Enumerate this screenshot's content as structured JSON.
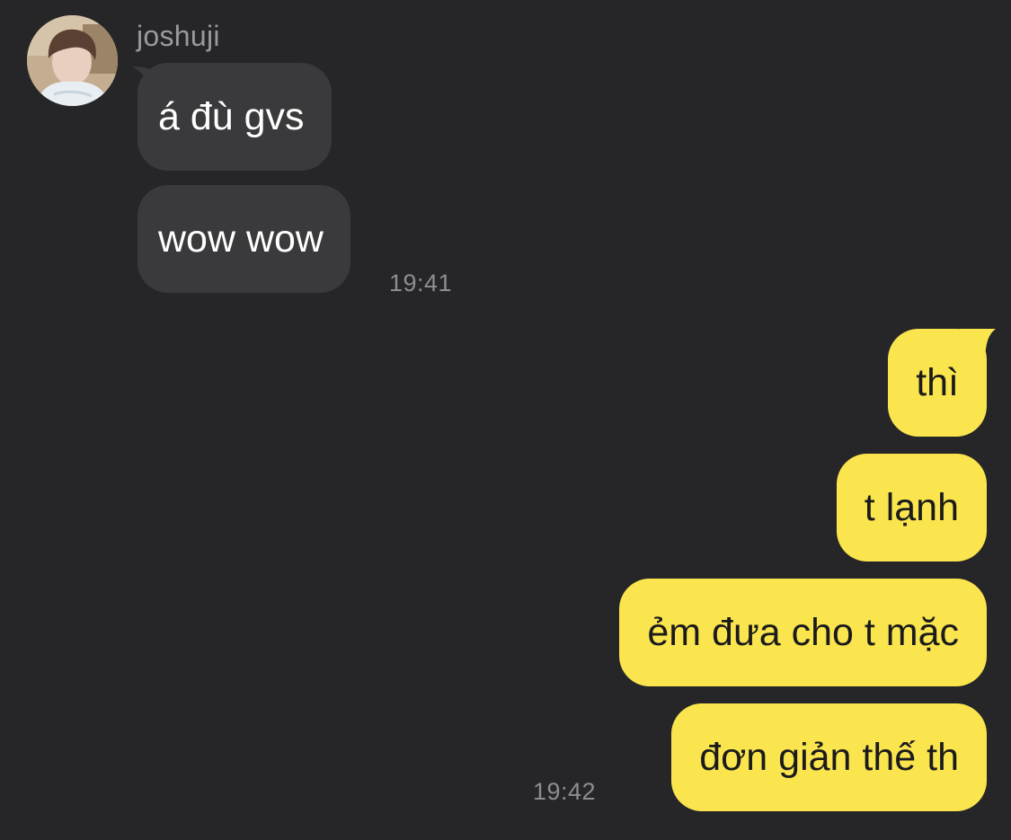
{
  "contact": {
    "name": "joshuji",
    "avatar_icon": "profile-photo-icon"
  },
  "incoming": {
    "messages": [
      "á đù gvs",
      "wow wow"
    ],
    "time": "19:41"
  },
  "outgoing": {
    "messages": [
      "thì",
      "t lạnh",
      "ẻm đưa cho t mặc",
      "đơn giản thế th"
    ],
    "time": "19:42"
  },
  "colors": {
    "background": "#262628",
    "incoming_bubble": "#3a3a3c",
    "outgoing_bubble": "#fae54f",
    "incoming_text": "#ffffff",
    "outgoing_text": "#1b1b1b",
    "meta_text": "#8d8d92"
  }
}
